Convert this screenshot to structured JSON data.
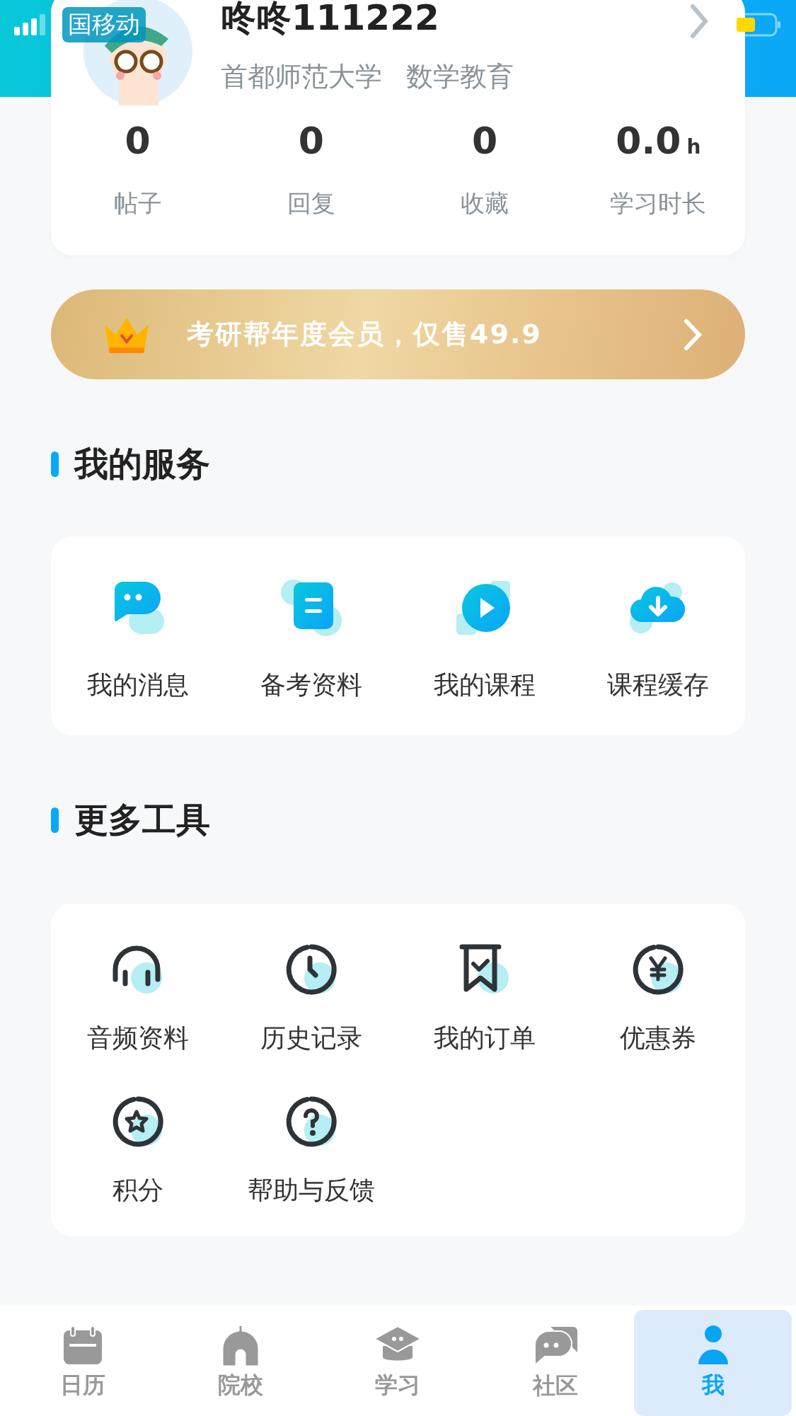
{
  "status_bar": {
    "carrier": "国移动"
  },
  "profile": {
    "name": "咚咚111222",
    "school": "首都师范大学",
    "major": "数学教育",
    "stats": [
      {
        "value": "0",
        "label": "帖子"
      },
      {
        "value": "0",
        "label": "回复"
      },
      {
        "value": "0",
        "label": "收藏"
      },
      {
        "value": "0.0",
        "unit": "h",
        "label": "学习时长"
      }
    ]
  },
  "banner": {
    "text": "考研帮年度会员，仅售49.9"
  },
  "sections": [
    {
      "title": "我的服务",
      "kind": "services",
      "items": [
        {
          "label": "我的消息"
        },
        {
          "label": "备考资料"
        },
        {
          "label": "我的课程"
        },
        {
          "label": "课程缓存"
        }
      ]
    },
    {
      "title": "更多工具",
      "kind": "tools",
      "items": [
        {
          "label": "音频资料"
        },
        {
          "label": "历史记录"
        },
        {
          "label": "我的订单"
        },
        {
          "label": "优惠券"
        },
        {
          "label": "积分"
        },
        {
          "label": "帮助与反馈"
        }
      ]
    }
  ],
  "tab_bar": [
    {
      "label": "日历",
      "selected": false
    },
    {
      "label": "院校",
      "selected": false
    },
    {
      "label": "学习",
      "selected": false
    },
    {
      "label": "社区",
      "selected": false
    },
    {
      "label": "我",
      "selected": true
    }
  ]
}
